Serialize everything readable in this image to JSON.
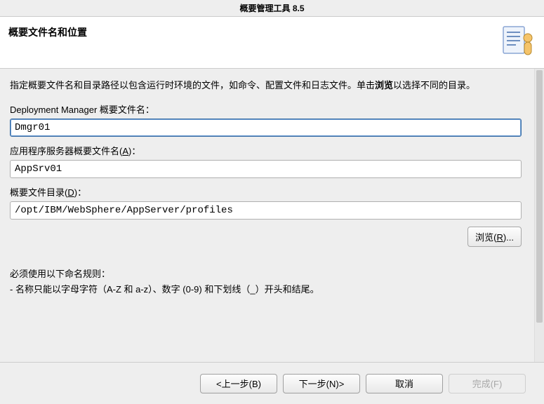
{
  "window": {
    "title": "概要管理工具 8.5"
  },
  "header": {
    "title": "概要文件名和位置"
  },
  "main": {
    "intro_prefix": "指定概要文件名和目录路径以包含运行时环境的文件，如命令、配置文件和日志文件。单击",
    "intro_bold": "浏览",
    "intro_suffix": "以选择不同的目录。",
    "dm_label": "Deployment Manager 概要文件名：",
    "dm_value": "Dmgr01",
    "app_label_prefix": "应用程序服务器概要文件名(",
    "app_label_key": "A",
    "app_label_suffix": ")：",
    "app_value": "AppSrv01",
    "dir_label_prefix": "概要文件目录(",
    "dir_label_key": "D",
    "dir_label_suffix": ")：",
    "dir_value": "/opt/IBM/WebSphere/AppServer/profiles",
    "browse_label_prefix": "浏览(",
    "browse_label_key": "R",
    "browse_label_suffix": ")...",
    "rules_title": "必须使用以下命名规则：",
    "rules_line1": "- 名称只能以字母字符（A-Z 和 a-z）、数字 (0-9) 和下划线（_）开头和结尾。"
  },
  "footer": {
    "back": "<上一步(B)",
    "next": "下一步(N)>",
    "cancel": "取消",
    "finish": "完成(F)"
  }
}
